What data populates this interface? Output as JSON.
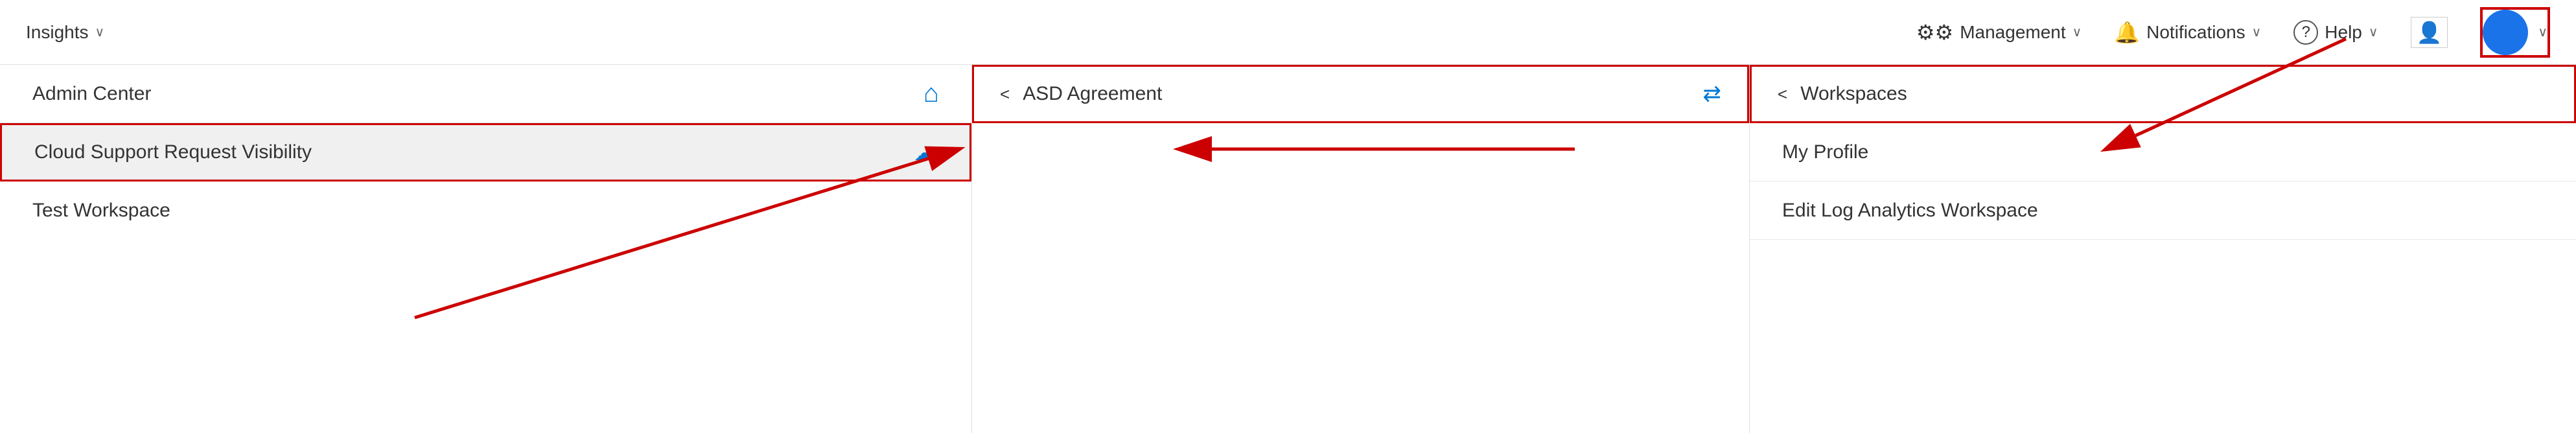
{
  "topbar": {
    "management_label": "Management",
    "notifications_label": "Notifications",
    "help_label": "Help",
    "insights_label": "Insights"
  },
  "left_panel": {
    "title": "Admin Center",
    "nav_items": [
      {
        "label": "Cloud Support Request Visibility",
        "has_cloud_icon": true,
        "highlighted": true
      },
      {
        "label": "Test Workspace",
        "has_cloud_icon": false,
        "highlighted": false
      }
    ]
  },
  "middle_panel": {
    "back_label": "<",
    "title": "ASD Agreement",
    "highlighted": true
  },
  "right_panel": {
    "back_label": "<",
    "title": "Workspaces",
    "highlighted": true,
    "nav_items": [
      {
        "label": "My Profile"
      },
      {
        "label": "Edit Log Analytics Workspace"
      }
    ]
  },
  "icons": {
    "gear": "⚙",
    "bell": "🔔",
    "help": "?",
    "person": "🧑",
    "chevron_down": "∨",
    "chevron_left": "<",
    "home": "⌂",
    "cloud": "☁",
    "sync": "⇄"
  }
}
